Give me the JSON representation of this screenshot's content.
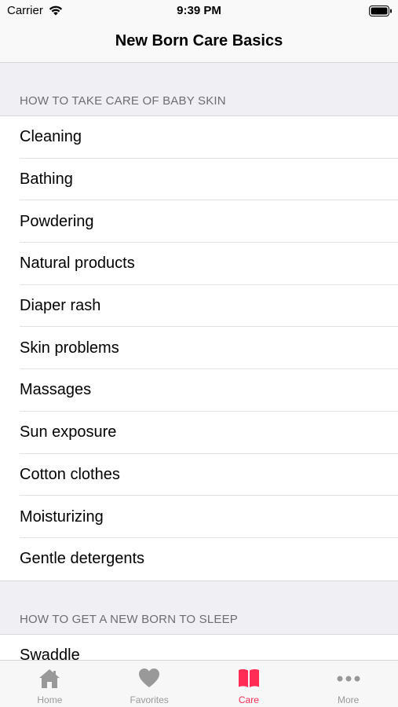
{
  "status_bar": {
    "carrier": "Carrier",
    "time": "9:39 PM"
  },
  "nav": {
    "title": "New Born Care Basics"
  },
  "sections": [
    {
      "header": "HOW TO TAKE CARE OF BABY SKIN",
      "items": [
        "Cleaning",
        "Bathing",
        "Powdering",
        "Natural products",
        "Diaper rash",
        "Skin problems",
        "Massages",
        "Sun exposure",
        "Cotton clothes",
        "Moisturizing",
        "Gentle detergents"
      ]
    },
    {
      "header": "HOW TO GET A NEW BORN TO SLEEP",
      "items": [
        "Swaddle"
      ]
    }
  ],
  "tabs": [
    {
      "label": "Home",
      "icon": "home-icon"
    },
    {
      "label": "Favorites",
      "icon": "heart-icon"
    },
    {
      "label": "Care",
      "icon": "book-icon",
      "active": true
    },
    {
      "label": "More",
      "icon": "more-icon"
    }
  ],
  "colors": {
    "accent": "#ff2d55",
    "inactive": "#999999",
    "background": "#efeff4"
  }
}
